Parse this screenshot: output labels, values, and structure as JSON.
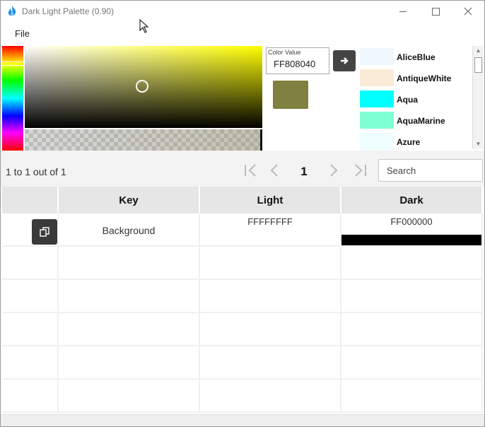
{
  "window": {
    "title": "Dark Light Palette (0.90)"
  },
  "menu": {
    "file_label": "File"
  },
  "picker": {
    "color_value_label": "Color Value",
    "color_value": "FF808040",
    "swatch_color": "#808040",
    "hue_color": "#ffff00",
    "named_colors": [
      {
        "name": "AliceBlue",
        "color": "#f0f8ff"
      },
      {
        "name": "AntiqueWhite",
        "color": "#faebd7"
      },
      {
        "name": "Aqua",
        "color": "#00ffff"
      },
      {
        "name": "AquaMarine",
        "color": "#7fffd4"
      },
      {
        "name": "Azure",
        "color": "#f0ffff"
      }
    ]
  },
  "pager": {
    "summary": "1 to 1 out of 1",
    "current_page": "1",
    "search_placeholder": "Search"
  },
  "grid": {
    "columns": [
      "",
      "Key",
      "Light",
      "Dark"
    ],
    "rows": [
      {
        "key": "Background",
        "light": "FFFFFFFF",
        "dark": "FF000000",
        "dark_color": "#000000"
      }
    ],
    "empty_rows": 5
  }
}
